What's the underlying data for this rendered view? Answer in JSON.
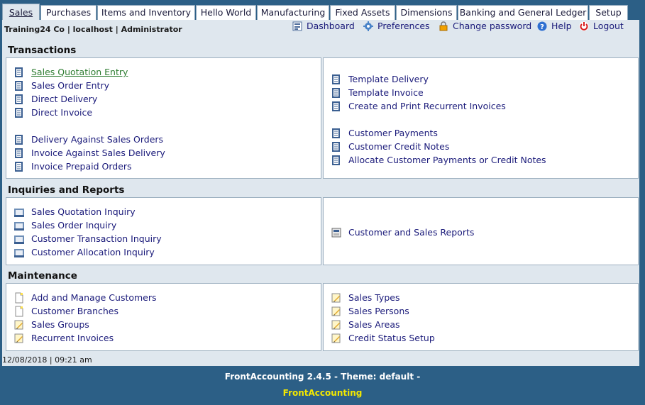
{
  "tabs": [
    "Sales",
    "Purchases",
    "Items and Inventory",
    "Hello World",
    "Manufacturing",
    "Fixed Assets",
    "Dimensions",
    "Banking and General Ledger",
    "Setup"
  ],
  "header": {
    "user_info": "Training24 Co | localhost | Administrator",
    "nav": {
      "dashboard": "Dashboard",
      "preferences": "Preferences",
      "change_password": "Change password",
      "help": "Help",
      "logout": "Logout"
    }
  },
  "sections": {
    "transactions": {
      "title": "Transactions",
      "left": [
        "Sales Quotation Entry",
        "Sales Order Entry",
        "Direct Delivery",
        "Direct Invoice",
        "Delivery Against Sales Orders",
        "Invoice Against Sales Delivery",
        "Invoice Prepaid Orders"
      ],
      "right": [
        "Template Delivery",
        "Template Invoice",
        "Create and Print Recurrent Invoices",
        "Customer Payments",
        "Customer Credit Notes",
        "Allocate Customer Payments or Credit Notes"
      ]
    },
    "inquiries": {
      "title": "Inquiries and Reports",
      "left": [
        "Sales Quotation Inquiry",
        "Sales Order Inquiry",
        "Customer Transaction Inquiry",
        "Customer Allocation Inquiry"
      ],
      "right": [
        "Customer and Sales Reports"
      ]
    },
    "maintenance": {
      "title": "Maintenance",
      "left": [
        "Add and Manage Customers",
        "Customer Branches",
        "Sales Groups",
        "Recurrent Invoices"
      ],
      "right": [
        "Sales Types",
        "Sales Persons",
        "Sales Areas",
        "Credit Status Setup"
      ]
    }
  },
  "status": {
    "datetime": "12/08/2018 | 09:21 am"
  },
  "footer": {
    "version": "FrontAccounting 2.4.5 - Theme: default -",
    "brand": "FrontAccounting"
  },
  "colors": {
    "page_bg": "#2c5f86",
    "content_bg": "#dfe7ee",
    "link": "#1a1a7a",
    "active_link": "#2e7d32",
    "brand": "#f3e800"
  }
}
